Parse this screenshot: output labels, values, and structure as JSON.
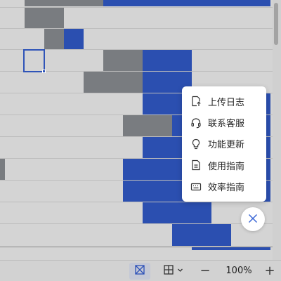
{
  "help_menu": {
    "items": [
      {
        "label": "上传日志",
        "icon": "upload-log-icon"
      },
      {
        "label": "联系客服",
        "icon": "headset-icon"
      },
      {
        "label": "功能更新",
        "icon": "lightbulb-icon"
      },
      {
        "label": "使用指南",
        "icon": "document-icon"
      },
      {
        "label": "效率指南",
        "icon": "keyboard-icon"
      }
    ],
    "close_icon": "close-icon"
  },
  "statusbar": {
    "zoom_level": "100%",
    "zoom_out_label": "−",
    "zoom_in_label": "+",
    "icons": [
      "normal-view-icon",
      "page-layout-icon",
      "chevron-down-icon"
    ]
  },
  "colors": {
    "bar_gray": "#797c80",
    "bar_blue": "#2b4fb0",
    "accent": "#2f54b8"
  }
}
